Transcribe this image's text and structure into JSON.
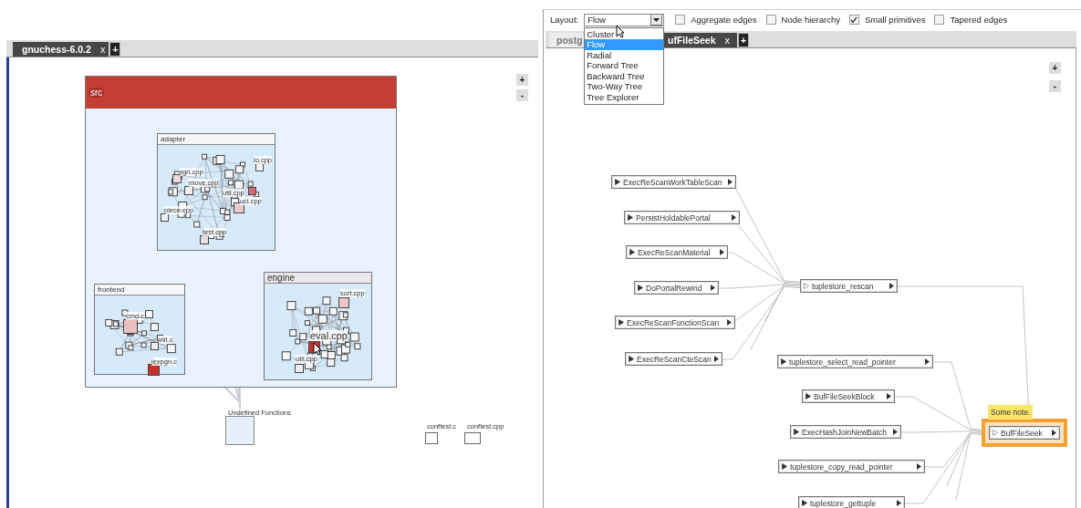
{
  "left_pane": {
    "tabs": [
      {
        "label": "gnuchess-6.0.2",
        "selected": true,
        "close": "x"
      }
    ],
    "add_tab": "+",
    "zoom": [
      "+",
      "-"
    ],
    "src": {
      "title": "src"
    },
    "folders": [
      {
        "title": "adapter",
        "files": [
          {
            "label": "pgn.cpp",
            "color": "#efd6da"
          },
          {
            "label": "move.cpp",
            "color": "#eeeeee"
          },
          {
            "label": "util.cpp",
            "color": "#d86b70"
          },
          {
            "label": "uci.cpp",
            "color": "#ecc9cf"
          },
          {
            "label": "io.cpp",
            "color": "#f5f5f5"
          },
          {
            "label": "piece.cpp",
            "color": "#f0f0f0"
          },
          {
            "label": "test.cpp",
            "color": "#e6dde0"
          }
        ]
      },
      {
        "title": "frontend",
        "files": [
          {
            "label": "cmd.c",
            "color": "#e9bfbf"
          },
          {
            "label": "init.c",
            "color": "#eeeeee"
          },
          {
            "label": "lexpgn.c",
            "color": "#c9302c"
          }
        ]
      },
      {
        "title": "engine",
        "files": [
          {
            "label": "sort.cpp",
            "color": "#ecc6c8"
          },
          {
            "label": "eval.cpp",
            "color": "#c9322c"
          },
          {
            "label": "util.cpp",
            "color": "#eeeeee"
          }
        ]
      }
    ],
    "undefined": {
      "label": "Undefined Functions"
    },
    "loose_files": [
      {
        "label": "conftest.c"
      },
      {
        "label": "conftest.cpp"
      }
    ]
  },
  "right_pane": {
    "toolbar": {
      "layout_label": "Layout:",
      "layout_value": "Flow",
      "dropdown_open": true,
      "options": [
        {
          "label": "Cluster",
          "selected": false
        },
        {
          "label": "Flow",
          "selected": true
        },
        {
          "label": "Radial",
          "selected": false
        },
        {
          "label": "Forward Tree",
          "selected": false
        },
        {
          "label": "Backward Tree",
          "selected": false
        },
        {
          "label": "Two-Way Tree",
          "selected": false
        },
        {
          "label": "Tree Explorer",
          "selected": false
        }
      ],
      "checkboxes": [
        {
          "label": "Aggregate edges",
          "checked": false
        },
        {
          "label": "Node hierarchy",
          "checked": false
        },
        {
          "label": "Small primitives",
          "checked": true
        },
        {
          "label": "Tapered edges",
          "checked": false
        }
      ]
    },
    "tabs": [
      {
        "label": "postg",
        "selected": false
      },
      {
        "label": "ufFileSeek",
        "selected": true,
        "close": "x"
      }
    ],
    "add_tab": "+",
    "zoom": [
      "+",
      "-"
    ],
    "nodes": [
      {
        "label": "ExecReScanWorkTableScan",
        "kind": "caller",
        "highlighted": false
      },
      {
        "label": "PersistHoldablePortal",
        "kind": "caller",
        "highlighted": false
      },
      {
        "label": "ExecReScanMaterial",
        "kind": "caller",
        "highlighted": false
      },
      {
        "label": "DoPortalRewind",
        "kind": "caller",
        "highlighted": false
      },
      {
        "label": "ExecReScanFunctionScan",
        "kind": "caller",
        "highlighted": false
      },
      {
        "label": "ExecReScanCteScan",
        "kind": "caller",
        "highlighted": false
      },
      {
        "label": "tuplestore_rescan",
        "kind": "open",
        "highlighted": false
      },
      {
        "label": "tuplestore_select_read_pointer",
        "kind": "caller",
        "highlighted": false
      },
      {
        "label": "BufFileSeekBlock",
        "kind": "caller",
        "highlighted": false
      },
      {
        "label": "ExecHashJoinNewBatch",
        "kind": "caller",
        "highlighted": false
      },
      {
        "label": "tuplestore_copy_read_pointer",
        "kind": "caller",
        "highlighted": false
      },
      {
        "label": "tuplestore_gettuple",
        "kind": "caller",
        "highlighted": false
      },
      {
        "label": "BufFileSeek",
        "kind": "open",
        "highlighted": true,
        "note": "Some note."
      }
    ]
  }
}
